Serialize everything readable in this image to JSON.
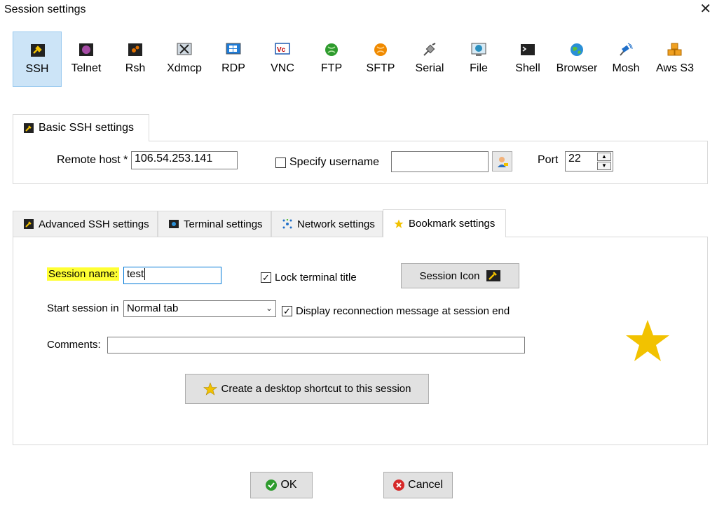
{
  "window": {
    "title": "Session settings",
    "close_glyph": "✕"
  },
  "protocols": [
    {
      "label": "SSH",
      "icon": "key-icon",
      "color": "#f2c200",
      "selected": true
    },
    {
      "label": "Telnet",
      "icon": "telnet-icon",
      "color": "#a64ca6"
    },
    {
      "label": "Rsh",
      "icon": "rsh-icon",
      "color": "#e07000"
    },
    {
      "label": "Xdmcp",
      "icon": "xdmcp-icon",
      "color": "#333333"
    },
    {
      "label": "RDP",
      "icon": "rdp-icon",
      "color": "#1e7bd6"
    },
    {
      "label": "VNC",
      "icon": "vnc-icon",
      "color": "#c00000"
    },
    {
      "label": "FTP",
      "icon": "ftp-icon",
      "color": "#2e9b2e"
    },
    {
      "label": "SFTP",
      "icon": "sftp-icon",
      "color": "#f08a00"
    },
    {
      "label": "Serial",
      "icon": "serial-icon",
      "color": "#7a7a7a"
    },
    {
      "label": "File",
      "icon": "file-icon",
      "color": "#2a8fbf"
    },
    {
      "label": "Shell",
      "icon": "shell-icon",
      "color": "#222222"
    },
    {
      "label": "Browser",
      "icon": "browser-icon",
      "color": "#2a8fd6"
    },
    {
      "label": "Mosh",
      "icon": "mosh-icon",
      "color": "#1f6fc9"
    },
    {
      "label": "Aws S3",
      "icon": "aws-s3-icon",
      "color": "#f0a020"
    }
  ],
  "basic": {
    "tab_label": "Basic SSH settings",
    "remote_host_label": "Remote host *",
    "remote_host_value": "106.54.253.141",
    "specify_username_label": "Specify username",
    "username_value": "",
    "port_label": "Port",
    "port_value": "22"
  },
  "tabs": [
    {
      "label": "Advanced SSH settings",
      "icon": "key-icon"
    },
    {
      "label": "Terminal settings",
      "icon": "terminal-icon"
    },
    {
      "label": "Network settings",
      "icon": "network-icon"
    },
    {
      "label": "Bookmark settings",
      "icon": "star-icon",
      "active": true
    }
  ],
  "bookmark": {
    "session_name_label": "Session name:",
    "session_name_value": "test",
    "lock_title_label": "Lock terminal title",
    "lock_title_checked": true,
    "session_icon_label": "Session Icon",
    "start_session_label": "Start session in",
    "start_session_value": "Normal tab",
    "display_reconnect_label": "Display reconnection message at session end",
    "display_reconnect_checked": true,
    "comments_label": "Comments:",
    "comments_value": "",
    "shortcut_label": "Create a desktop shortcut to this session"
  },
  "footer": {
    "ok_label": "OK",
    "cancel_label": "Cancel"
  },
  "colors": {
    "selected_bg": "#cce4f7",
    "highlight": "#ffff33",
    "star": "#f2c200",
    "ok_green": "#2e9b2e",
    "cancel_red": "#d62828"
  }
}
